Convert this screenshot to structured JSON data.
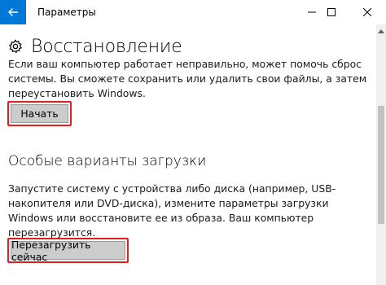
{
  "window": {
    "title": "Параметры"
  },
  "recovery": {
    "heading": "Восстановление",
    "description": "Если ваш компьютер работает неправильно, может помочь сброс системы. Вы сможете сохранить или удалить свои файлы, а затем переустановить Windows.",
    "start_button": "Начать"
  },
  "advanced_startup": {
    "heading": "Особые варианты загрузки",
    "description": "Запустите систему с устройства либо диска (например, USB-накопителя или DVD-диска), измените параметры загрузки Windows или восстановите ее из образа. Ваш компьютер перезагрузится.",
    "restart_button": "Перезагрузить сейчас"
  },
  "colors": {
    "accent": "#0078d7",
    "highlight_border": "#e01e1e"
  },
  "icons": {
    "back": "back-arrow-icon",
    "minimize": "minimize-icon",
    "maximize": "maximize-icon",
    "close": "close-icon",
    "settings": "gear-icon"
  }
}
